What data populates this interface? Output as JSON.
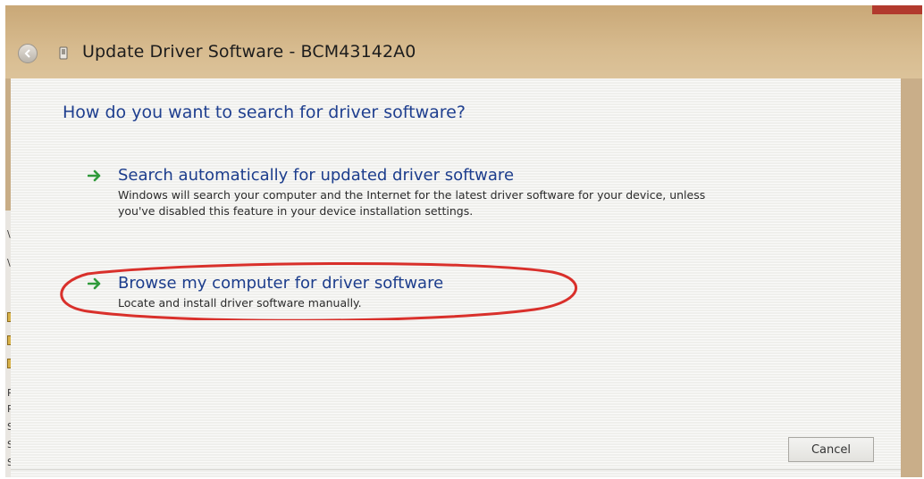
{
  "window": {
    "title": "Update Driver Software - BCM43142A0"
  },
  "dialog": {
    "question": "How do you want to search for driver software?",
    "options": [
      {
        "title": "Search automatically for updated driver software",
        "description": "Windows will search your computer and the Internet for the latest driver software for your device, unless you've disabled this feature in your device installation settings."
      },
      {
        "title": "Browse my computer for driver software",
        "description": "Locate and install driver software manually."
      }
    ],
    "cancel_label": "Cancel"
  },
  "background_window": {
    "items": [
      "\\",
      "\\",
      "Pr",
      "Pr",
      "Sc",
      "St",
      "Sy"
    ]
  },
  "colors": {
    "question_text": "#1f3f8f",
    "option_title": "#1c3d8c",
    "arrow_green": "#2f9a3a",
    "annotation_red": "#d9302b",
    "title_bar": "#d7bb8f"
  },
  "icons": {
    "back": "back-arrow-icon",
    "device": "device-icon",
    "option_arrow": "green-arrow-icon"
  }
}
